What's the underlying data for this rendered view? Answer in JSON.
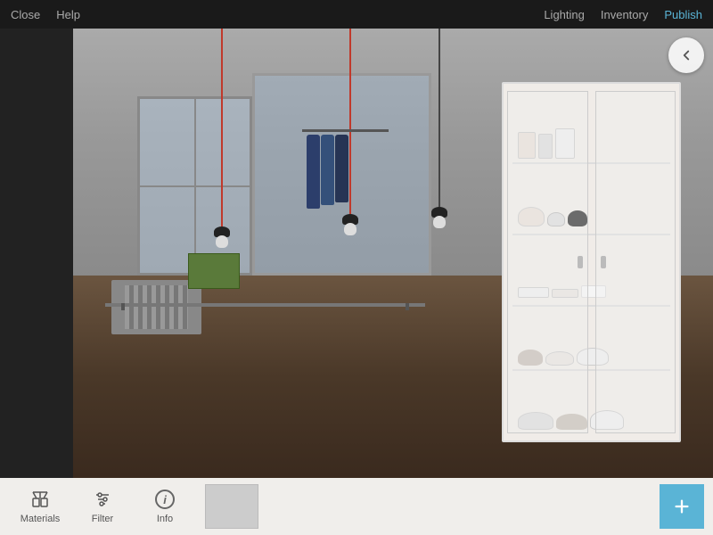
{
  "topbar": {
    "close_label": "Close",
    "help_label": "Help",
    "lighting_label": "Lighting",
    "inventory_label": "Inventory",
    "publish_label": "Publish"
  },
  "toolbar": {
    "materials_label": "Materials",
    "filter_label": "Filter",
    "info_label": "Info"
  },
  "back_button_title": "Back",
  "add_button_label": "+"
}
